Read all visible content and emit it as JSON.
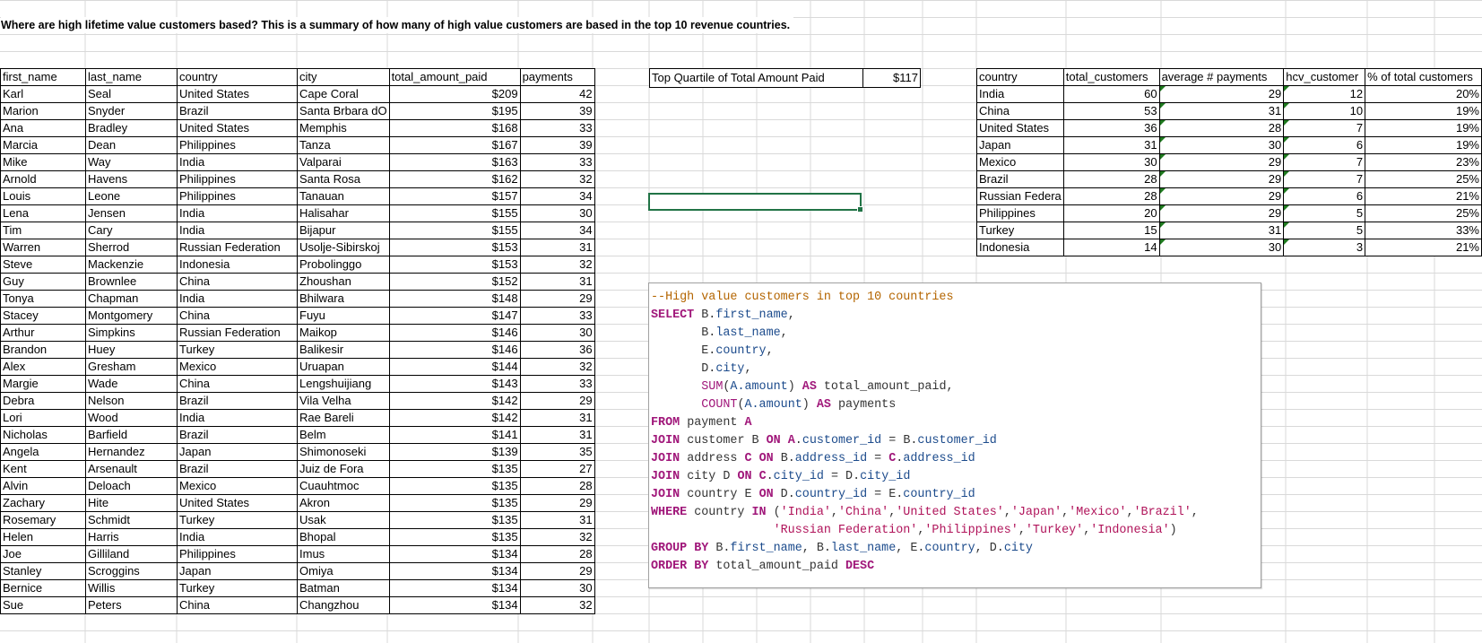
{
  "heading": "Where are high lifetime value customers based? This is a  summary of how many of high value customers are based in the top 10 revenue countries.",
  "customers": {
    "headers": [
      "first_name",
      "last_name",
      "country",
      "city",
      "total_amount_paid",
      "payments"
    ],
    "rows": [
      [
        "Karl",
        "Seal",
        "United States",
        "Cape Coral",
        "$209",
        "42"
      ],
      [
        "Marion",
        "Snyder",
        "Brazil",
        "Santa Brbara dO",
        "$195",
        "39"
      ],
      [
        "Ana",
        "Bradley",
        "United States",
        "Memphis",
        "$168",
        "33"
      ],
      [
        "Marcia",
        "Dean",
        "Philippines",
        "Tanza",
        "$167",
        "39"
      ],
      [
        "Mike",
        "Way",
        "India",
        "Valparai",
        "$163",
        "33"
      ],
      [
        "Arnold",
        "Havens",
        "Philippines",
        "Santa Rosa",
        "$162",
        "32"
      ],
      [
        "Louis",
        "Leone",
        "Philippines",
        "Tanauan",
        "$157",
        "34"
      ],
      [
        "Lena",
        "Jensen",
        "India",
        "Halisahar",
        "$155",
        "30"
      ],
      [
        "Tim",
        "Cary",
        "India",
        "Bijapur",
        "$155",
        "34"
      ],
      [
        "Warren",
        "Sherrod",
        "Russian Federation",
        "Usolje-Sibirskoj",
        "$153",
        "31"
      ],
      [
        "Steve",
        "Mackenzie",
        "Indonesia",
        "Probolinggo",
        "$153",
        "32"
      ],
      [
        "Guy",
        "Brownlee",
        "China",
        "Zhoushan",
        "$152",
        "31"
      ],
      [
        "Tonya",
        "Chapman",
        "India",
        "Bhilwara",
        "$148",
        "29"
      ],
      [
        "Stacey",
        "Montgomery",
        "China",
        "Fuyu",
        "$147",
        "33"
      ],
      [
        "Arthur",
        "Simpkins",
        "Russian Federation",
        "Maikop",
        "$146",
        "30"
      ],
      [
        "Brandon",
        "Huey",
        "Turkey",
        "Balikesir",
        "$146",
        "36"
      ],
      [
        "Alex",
        "Gresham",
        "Mexico",
        "Uruapan",
        "$144",
        "32"
      ],
      [
        "Margie",
        "Wade",
        "China",
        "Lengshuijiang",
        "$143",
        "33"
      ],
      [
        "Debra",
        "Nelson",
        "Brazil",
        "Vila Velha",
        "$142",
        "29"
      ],
      [
        "Lori",
        "Wood",
        "India",
        "Rae Bareli",
        "$142",
        "31"
      ],
      [
        "Nicholas",
        "Barfield",
        "Brazil",
        "Belm",
        "$141",
        "31"
      ],
      [
        "Angela",
        "Hernandez",
        "Japan",
        "Shimonoseki",
        "$139",
        "35"
      ],
      [
        "Kent",
        "Arsenault",
        "Brazil",
        "Juiz de Fora",
        "$135",
        "27"
      ],
      [
        "Alvin",
        "Deloach",
        "Mexico",
        "Cuauhtmoc",
        "$135",
        "28"
      ],
      [
        "Zachary",
        "Hite",
        "United States",
        "Akron",
        "$135",
        "29"
      ],
      [
        "Rosemary",
        "Schmidt",
        "Turkey",
        "Usak",
        "$135",
        "31"
      ],
      [
        "Helen",
        "Harris",
        "India",
        "Bhopal",
        "$135",
        "32"
      ],
      [
        "Joe",
        "Gilliland",
        "Philippines",
        "Imus",
        "$134",
        "28"
      ],
      [
        "Stanley",
        "Scroggins",
        "Japan",
        "Omiya",
        "$134",
        "29"
      ],
      [
        "Bernice",
        "Willis",
        "Turkey",
        "Batman",
        "$134",
        "30"
      ],
      [
        "Sue",
        "Peters",
        "China",
        "Changzhou",
        "$134",
        "32"
      ]
    ]
  },
  "quartile": {
    "label": "Top Quartile of Total Amount Paid",
    "value": "$117"
  },
  "summary": {
    "headers": [
      "country",
      "total_customers",
      "average # payments",
      "hcv_customer",
      "% of total customers"
    ],
    "rows": [
      [
        "India",
        "60",
        "29",
        "12",
        "20%"
      ],
      [
        "China",
        "53",
        "31",
        "10",
        "19%"
      ],
      [
        "United States",
        "36",
        "28",
        "7",
        "19%"
      ],
      [
        "Japan",
        "31",
        "30",
        "6",
        "19%"
      ],
      [
        "Mexico",
        "30",
        "29",
        "7",
        "23%"
      ],
      [
        "Brazil",
        "28",
        "29",
        "7",
        "25%"
      ],
      [
        "Russian Federa",
        "28",
        "29",
        "6",
        "21%"
      ],
      [
        "Philippines",
        "20",
        "29",
        "5",
        "25%"
      ],
      [
        "Turkey",
        "15",
        "31",
        "5",
        "33%"
      ],
      [
        "Indonesia",
        "14",
        "30",
        "3",
        "21%"
      ]
    ]
  },
  "sql": {
    "lines": [
      [
        [
          "comment",
          "--High value customers in top 10 countries"
        ]
      ],
      [
        [
          "kw",
          "SELECT "
        ],
        [
          "plain",
          "B."
        ],
        [
          "id",
          "first_name"
        ],
        [
          "plain",
          ","
        ]
      ],
      [
        [
          "plain",
          "       B."
        ],
        [
          "id",
          "last_name"
        ],
        [
          "plain",
          ","
        ]
      ],
      [
        [
          "plain",
          "       E."
        ],
        [
          "id",
          "country"
        ],
        [
          "plain",
          ","
        ]
      ],
      [
        [
          "plain",
          "       D."
        ],
        [
          "id",
          "city"
        ],
        [
          "plain",
          ","
        ]
      ],
      [
        [
          "plain",
          "       "
        ],
        [
          "fn",
          "SUM"
        ],
        [
          "plain",
          "("
        ],
        [
          "id",
          "A.amount"
        ],
        [
          "plain",
          ") "
        ],
        [
          "kw",
          "AS"
        ],
        [
          "plain",
          " total_amount_paid,"
        ]
      ],
      [
        [
          "plain",
          "       "
        ],
        [
          "fn",
          "COUNT"
        ],
        [
          "plain",
          "("
        ],
        [
          "id",
          "A.amount"
        ],
        [
          "plain",
          ") "
        ],
        [
          "kw",
          "AS"
        ],
        [
          "plain",
          " payments"
        ]
      ],
      [
        [
          "kw",
          "FROM"
        ],
        [
          "plain",
          " payment "
        ],
        [
          "kw",
          "A"
        ]
      ],
      [
        [
          "kw",
          "JOIN"
        ],
        [
          "plain",
          " customer B "
        ],
        [
          "kw",
          "ON"
        ],
        [
          "plain",
          " "
        ],
        [
          "kw",
          "A"
        ],
        [
          "plain",
          "."
        ],
        [
          "id",
          "customer_id"
        ],
        [
          "plain",
          " = B."
        ],
        [
          "id",
          "customer_id"
        ]
      ],
      [
        [
          "kw",
          "JOIN"
        ],
        [
          "plain",
          " address "
        ],
        [
          "kw",
          "C"
        ],
        [
          "plain",
          " "
        ],
        [
          "kw",
          "ON"
        ],
        [
          "plain",
          " B."
        ],
        [
          "id",
          "address_id"
        ],
        [
          "plain",
          " = "
        ],
        [
          "kw",
          "C"
        ],
        [
          "plain",
          "."
        ],
        [
          "id",
          "address_id"
        ]
      ],
      [
        [
          "kw",
          "JOIN"
        ],
        [
          "plain",
          " city D "
        ],
        [
          "kw",
          "ON"
        ],
        [
          "plain",
          " "
        ],
        [
          "kw",
          "C"
        ],
        [
          "plain",
          "."
        ],
        [
          "id",
          "city_id"
        ],
        [
          "plain",
          " = D."
        ],
        [
          "id",
          "city_id"
        ]
      ],
      [
        [
          "kw",
          "JOIN"
        ],
        [
          "plain",
          " country E "
        ],
        [
          "kw",
          "ON"
        ],
        [
          "plain",
          " D."
        ],
        [
          "id",
          "country_id"
        ],
        [
          "plain",
          " = E."
        ],
        [
          "id",
          "country_id"
        ]
      ],
      [
        [
          "kw",
          "WHERE"
        ],
        [
          "plain",
          " country "
        ],
        [
          "kw",
          "IN"
        ],
        [
          "plain",
          " ("
        ],
        [
          "str",
          "'India'"
        ],
        [
          "plain",
          ","
        ],
        [
          "str",
          "'China'"
        ],
        [
          "plain",
          ","
        ],
        [
          "str",
          "'United States'"
        ],
        [
          "plain",
          ","
        ],
        [
          "str",
          "'Japan'"
        ],
        [
          "plain",
          ","
        ],
        [
          "str",
          "'Mexico'"
        ],
        [
          "plain",
          ","
        ],
        [
          "str",
          "'Brazil'"
        ],
        [
          "plain",
          ","
        ]
      ],
      [
        [
          "plain",
          "                 "
        ],
        [
          "str",
          "'Russian Federation'"
        ],
        [
          "plain",
          ","
        ],
        [
          "str",
          "'Philippines'"
        ],
        [
          "plain",
          ","
        ],
        [
          "str",
          "'Turkey'"
        ],
        [
          "plain",
          ","
        ],
        [
          "str",
          "'Indonesia'"
        ],
        [
          "plain",
          ")"
        ]
      ],
      [
        [
          "kw",
          "GROUP BY"
        ],
        [
          "plain",
          " B."
        ],
        [
          "id",
          "first_name"
        ],
        [
          "plain",
          ", B."
        ],
        [
          "id",
          "last_name"
        ],
        [
          "plain",
          ", E."
        ],
        [
          "id",
          "country"
        ],
        [
          "plain",
          ", D."
        ],
        [
          "id",
          "city"
        ]
      ],
      [
        [
          "kw",
          "ORDER BY"
        ],
        [
          "plain",
          " total_amount_paid "
        ],
        [
          "kw",
          "DESC"
        ]
      ]
    ]
  },
  "colors": {
    "gridline": "#d9d9d9",
    "selection": "#217346",
    "error_triangle": "#1f7a1f"
  }
}
